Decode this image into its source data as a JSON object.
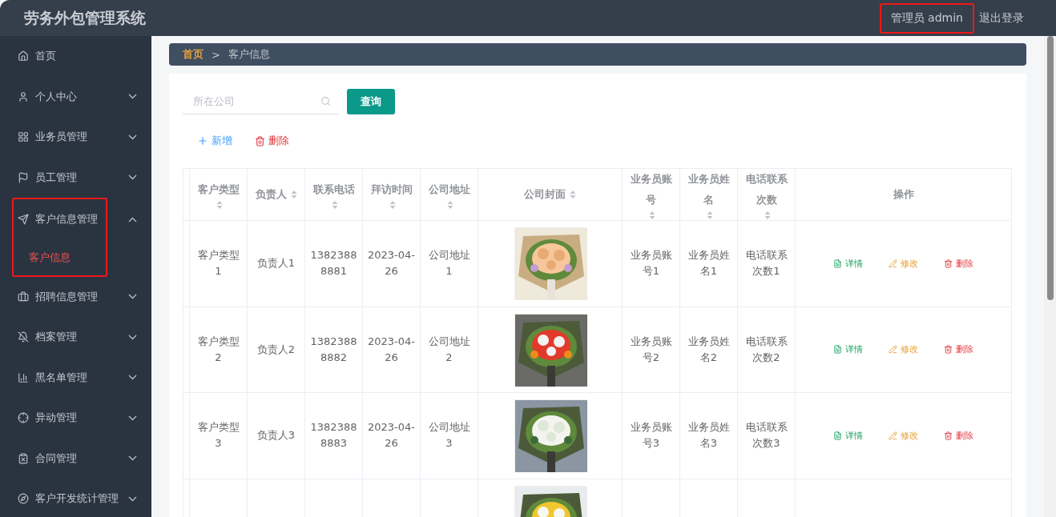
{
  "header": {
    "title": "劳务外包管理系统",
    "user": {
      "label": "管理员 admin",
      "highlighted": true
    },
    "logout": "退出登录"
  },
  "sidebar": {
    "items": [
      {
        "label": "首页",
        "expandable": false,
        "highlighted": false
      },
      {
        "label": "个人中心",
        "expandable": true,
        "expanded": false,
        "highlighted": false
      },
      {
        "label": "业务员管理",
        "expandable": true,
        "expanded": false,
        "highlighted": false
      },
      {
        "label": "员工管理",
        "expandable": true,
        "expanded": false,
        "highlighted": false
      },
      {
        "label": "客户信息管理",
        "expandable": true,
        "expanded": true,
        "highlighted": true,
        "children": [
          {
            "label": "客户信息",
            "selected": true
          }
        ]
      },
      {
        "label": "招聘信息管理",
        "expandable": true,
        "expanded": false,
        "highlighted": false
      },
      {
        "label": "档案管理",
        "expandable": true,
        "expanded": false,
        "highlighted": false
      },
      {
        "label": "黑名单管理",
        "expandable": true,
        "expanded": false,
        "highlighted": false
      },
      {
        "label": "异动管理",
        "expandable": true,
        "expanded": false,
        "highlighted": false
      },
      {
        "label": "合同管理",
        "expandable": true,
        "expanded": false,
        "highlighted": false
      },
      {
        "label": "客户开发统计管理",
        "expandable": true,
        "expanded": false,
        "highlighted": false
      }
    ]
  },
  "breadcrumb": {
    "home": "首页",
    "separator": ">",
    "current": "客户信息"
  },
  "search": {
    "placeholder": "所在公司",
    "button": "查询"
  },
  "toolbar": {
    "add": "新增",
    "delete": "删除"
  },
  "table": {
    "columns": [
      {
        "label": "客户类型",
        "sortable": true
      },
      {
        "label": "负责人",
        "sortable": true
      },
      {
        "label": "联系电话",
        "sortable": true
      },
      {
        "label": "拜访时间",
        "sortable": true
      },
      {
        "label": "公司地址",
        "sortable": true
      },
      {
        "label": "公司封面",
        "sortable": true
      },
      {
        "label": "业务员账号",
        "sortable": true
      },
      {
        "label": "业务员姓名",
        "sortable": true
      },
      {
        "label": "电话联系次数",
        "sortable": true
      },
      {
        "label": "操作",
        "sortable": false
      }
    ],
    "rows": [
      {
        "cells": [
          "客户类型1",
          "负责人1",
          "13823888881",
          "2023-04-26",
          "公司地址1",
          {
            "kind": "picture"
          },
          "业务员账号1",
          "业务员姓名1",
          "电话联系次数1"
        ],
        "actions": [
          "详情",
          "修改",
          "删除"
        ]
      },
      {
        "cells": [
          "客户类型2",
          "负责人2",
          "13823888882",
          "2023-04-26",
          "公司地址2",
          {
            "kind": "picture"
          },
          "业务员账号2",
          "业务员姓名2",
          "电话联系次数2"
        ],
        "actions": [
          "详情",
          "修改",
          "删除"
        ]
      },
      {
        "cells": [
          "客户类型3",
          "负责人3",
          "13823888883",
          "2023-04-26",
          "公司地址3",
          {
            "kind": "picture"
          },
          "业务员账号3",
          "业务员姓名3",
          "电话联系次数3"
        ],
        "actions": [
          "详情",
          "修改",
          "删除"
        ]
      }
    ]
  }
}
